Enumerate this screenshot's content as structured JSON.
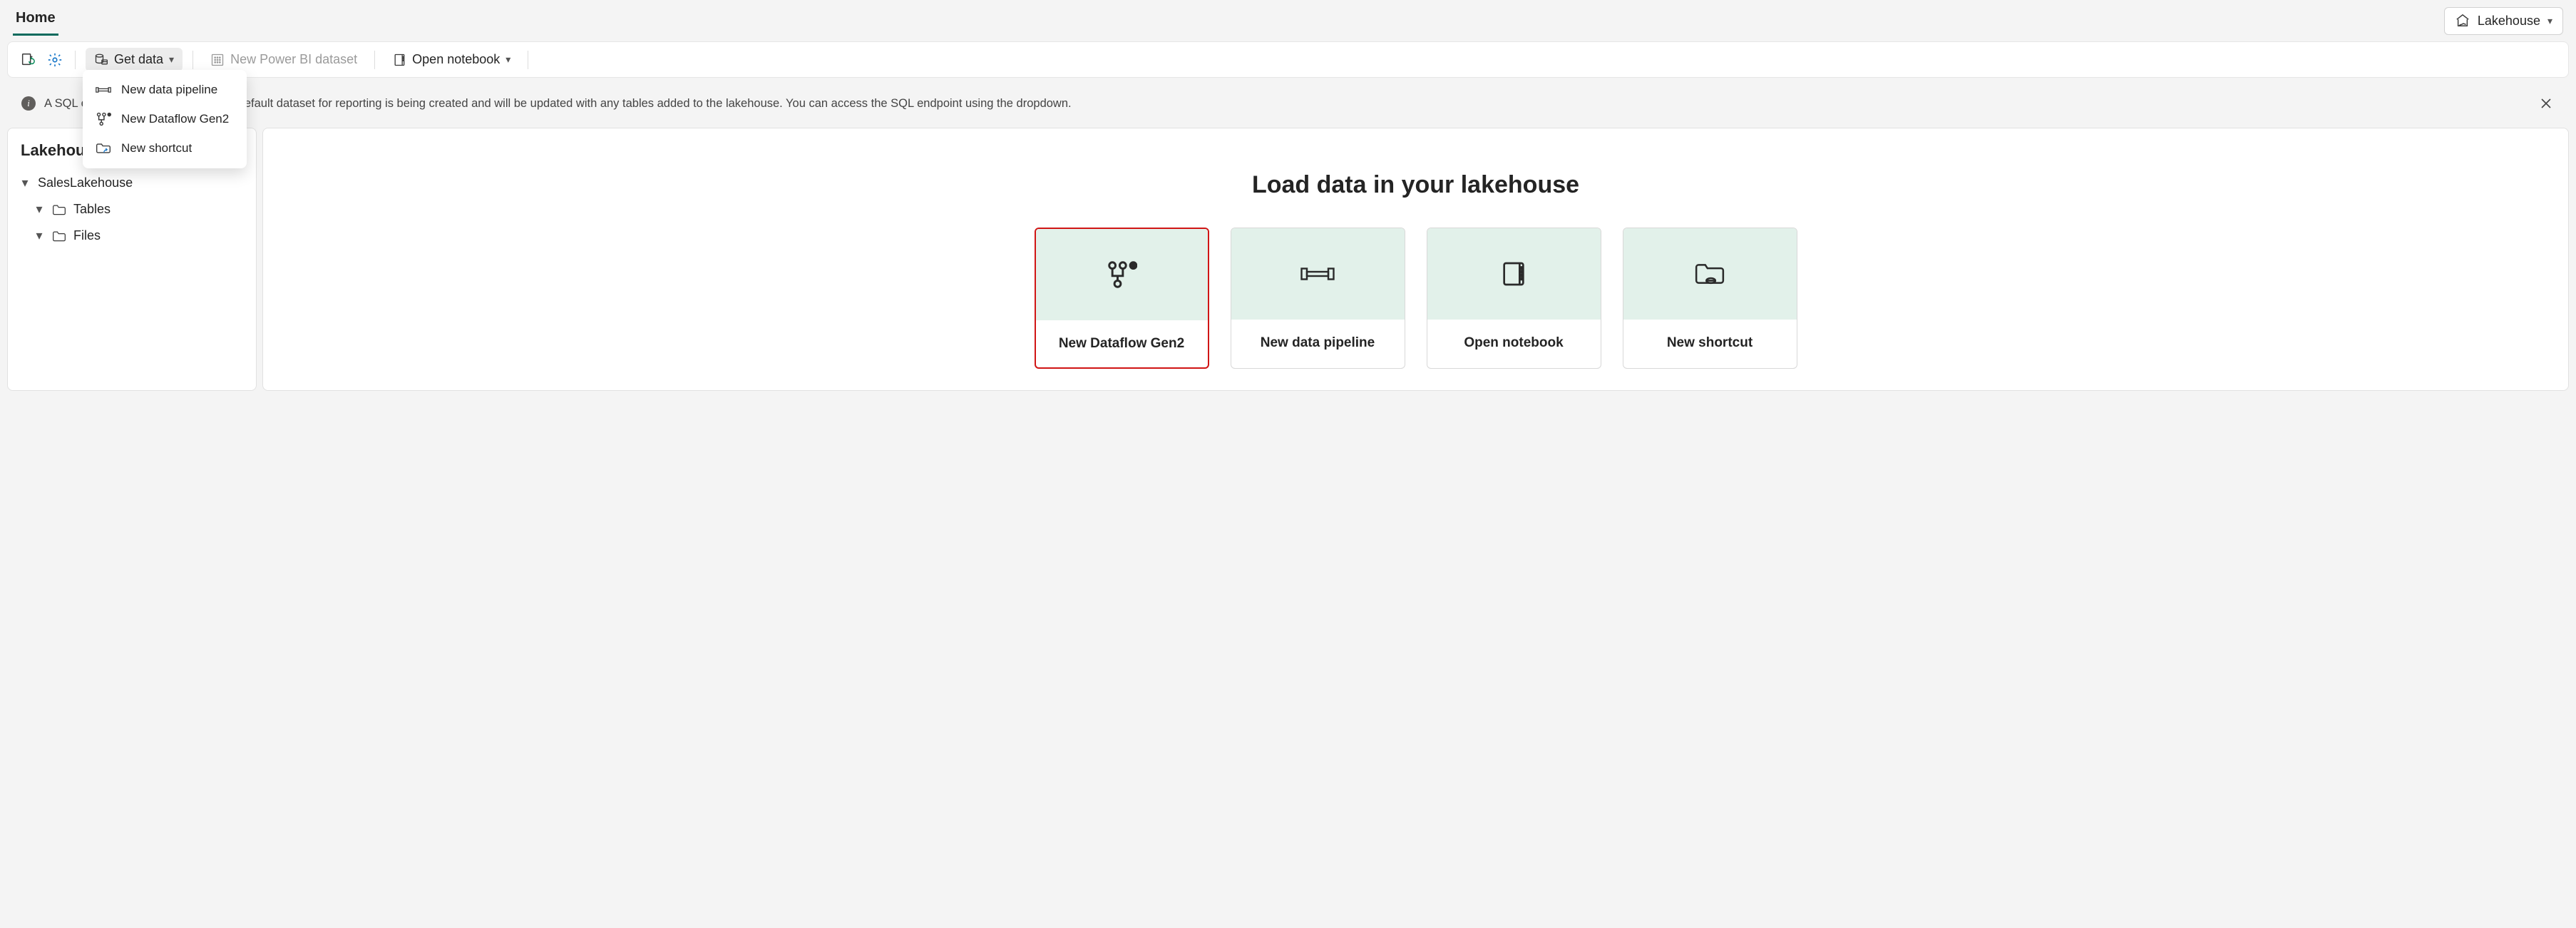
{
  "header": {
    "tab_label": "Home",
    "workspace_label": "Lakehouse"
  },
  "toolbar": {
    "get_data_label": "Get data",
    "new_dataset_label": "New Power BI dataset",
    "open_notebook_label": "Open notebook"
  },
  "get_data_menu": {
    "items": [
      {
        "label": "New data pipeline",
        "icon": "pipeline-icon"
      },
      {
        "label": "New Dataflow Gen2",
        "icon": "dataflow-icon"
      },
      {
        "label": "New shortcut",
        "icon": "shortcut-folder-icon"
      }
    ]
  },
  "info_bar": {
    "prefix": "A SQL e",
    "suffix": "efault dataset for reporting is being created and will be updated with any tables added to the lakehouse. You can access the SQL endpoint using the dropdown."
  },
  "sidebar": {
    "title": "Lakehous",
    "root_label": "SalesLakehouse",
    "children": [
      {
        "label": "Tables"
      },
      {
        "label": "Files"
      }
    ]
  },
  "main": {
    "title": "Load data in your lakehouse",
    "cards": [
      {
        "label": "New Dataflow Gen2",
        "icon": "dataflow-icon",
        "selected": true
      },
      {
        "label": "New data pipeline",
        "icon": "pipeline-icon",
        "selected": false
      },
      {
        "label": "Open notebook",
        "icon": "notebook-icon",
        "selected": false
      },
      {
        "label": "New shortcut",
        "icon": "shortcut-folder-icon",
        "selected": false
      }
    ]
  }
}
